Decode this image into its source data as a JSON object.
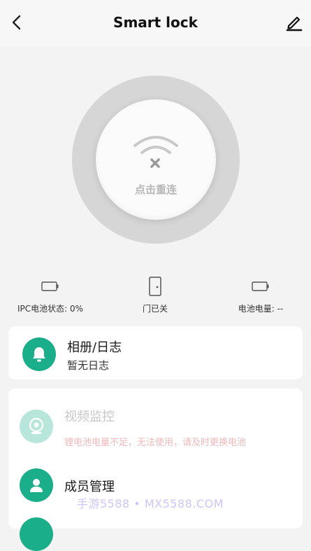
{
  "header": {
    "title": "Smart lock"
  },
  "lock_button": {
    "label": "点击重连"
  },
  "status": {
    "ipc_battery": "IPC电池状态: 0%",
    "door_state": "门已关",
    "battery_level": "电池电量: --"
  },
  "album": {
    "title": "相册/日志",
    "subtitle": "暂无日志"
  },
  "menu": {
    "video_title": "视频监控",
    "video_warning": "锂电池电量不足，无法使用，请及时更换电池",
    "members_title": "成员管理"
  },
  "watermark": "手游5588 • MX5588.COM",
  "colors": {
    "accent": "#1bae8b",
    "accent_faded": "#b9e6db",
    "warning_text": "#f0b8ba"
  }
}
